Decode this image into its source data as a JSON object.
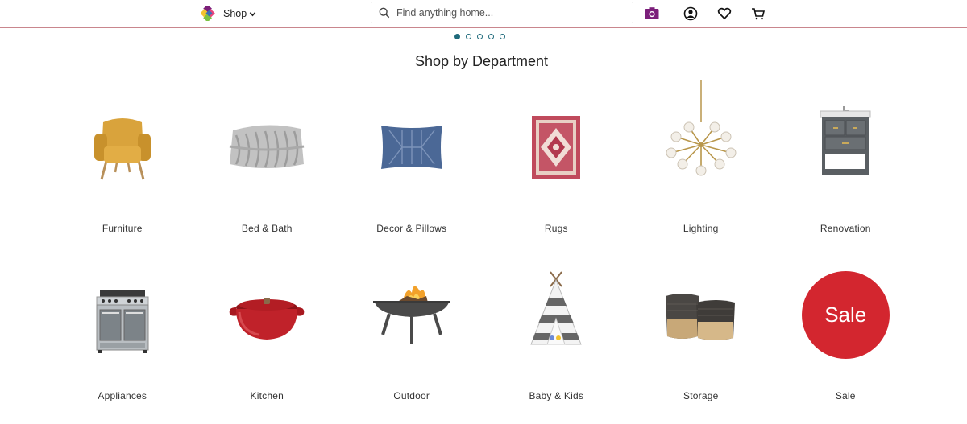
{
  "header": {
    "shop_label": "Shop",
    "search_placeholder": "Find anything home..."
  },
  "carousel": {
    "dots": 5,
    "active": 1
  },
  "section_title": "Shop by Department",
  "departments": [
    {
      "label": "Furniture",
      "icon": "armchair-image"
    },
    {
      "label": "Bed & Bath",
      "icon": "knit-blanket-image"
    },
    {
      "label": "Decor & Pillows",
      "icon": "pillow-image"
    },
    {
      "label": "Rugs",
      "icon": "rug-image"
    },
    {
      "label": "Lighting",
      "icon": "chandelier-image"
    },
    {
      "label": "Renovation",
      "icon": "vanity-image"
    },
    {
      "label": "Appliances",
      "icon": "range-oven-image"
    },
    {
      "label": "Kitchen",
      "icon": "dutch-oven-image"
    },
    {
      "label": "Outdoor",
      "icon": "fire-pit-image"
    },
    {
      "label": "Baby & Kids",
      "icon": "teepee-image"
    },
    {
      "label": "Storage",
      "icon": "baskets-image"
    },
    {
      "label": "Sale",
      "icon": "sale-badge",
      "badge_text": "Sale"
    }
  ],
  "colors": {
    "accent": "#1f6a7b",
    "camera": "#7b1f7a",
    "sale": "#d3262f",
    "divider": "#c9868d"
  }
}
